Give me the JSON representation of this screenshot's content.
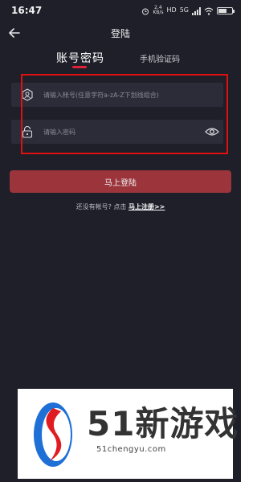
{
  "status_bar": {
    "time": "16:47",
    "net_speed_value": "2.4",
    "net_speed_unit": "KB/s",
    "hd_label": "HD",
    "signal_label": "5G",
    "battery_level": 0.6
  },
  "header": {
    "title": "登陆"
  },
  "tabs": {
    "account_label": "账号密码",
    "phone_label": "手机验证码",
    "active": "account"
  },
  "form": {
    "account_placeholder": "请输入帐号(任意字符a-zA-Z下划线组合)",
    "password_placeholder": "请输入密码",
    "submit_label": "马上登陆"
  },
  "register": {
    "prompt": "还没有帐号? 点击",
    "link_label": "马上注册>>"
  },
  "watermark": {
    "title": "51新游戏",
    "url": "51chengyu.com"
  },
  "colors": {
    "background": "#1e1f29",
    "accent": "#e0213a",
    "button": "#9b343b",
    "highlight": "#e01010"
  }
}
